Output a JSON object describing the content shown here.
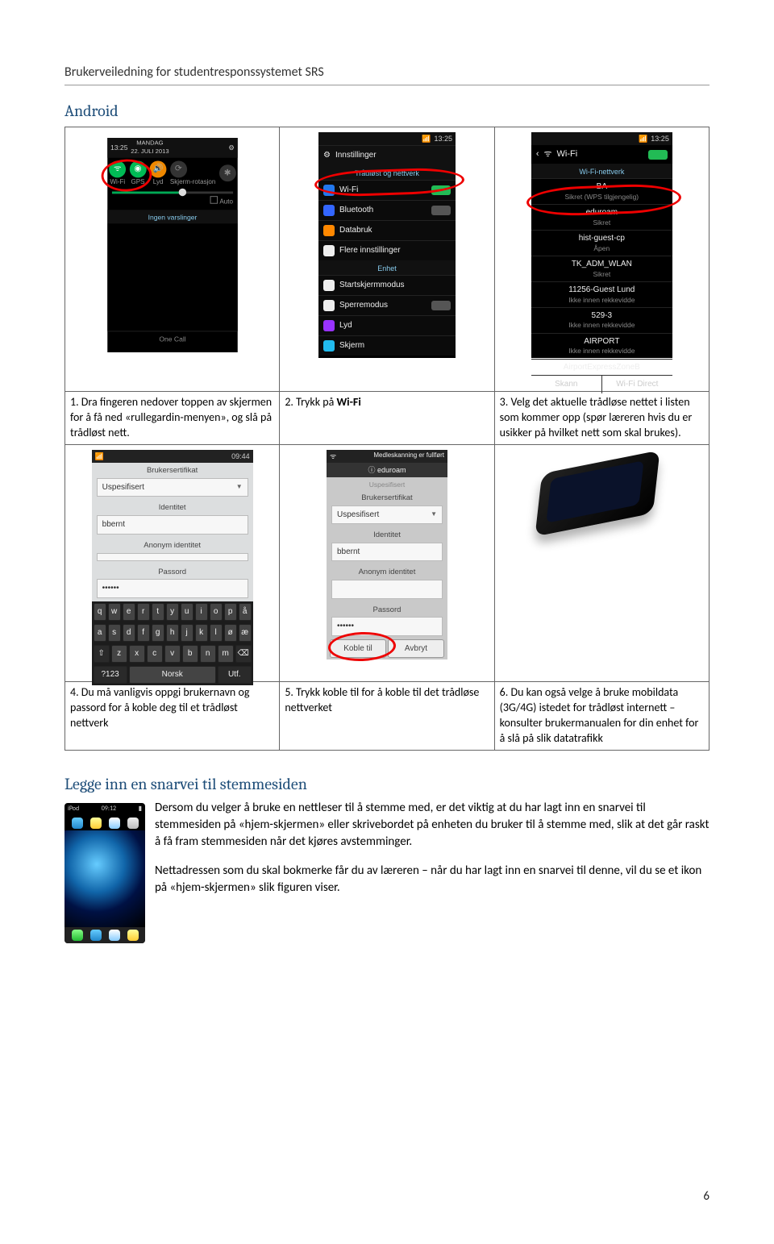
{
  "doc": {
    "header": "Brukerveiledning for studentresponssystemet SRS",
    "section_android": "Android",
    "section_shortcut": "Legge inn en snarvei til stemmesiden",
    "page_number": "6"
  },
  "steps_row1": {
    "c1": "1. Dra fingeren nedover toppen av skjermen for å få ned «rullegardin-menyen», og slå på trådløst nett.",
    "c2_pre": "2. Trykk på ",
    "c2_bold": "Wi-Fi",
    "c3": "3. Velg det aktuelle trådløse nettet i listen som kommer opp (spør læreren hvis du er usikker på hvilket nett som skal brukes)."
  },
  "steps_row2": {
    "c1": "4. Du må vanligvis oppgi brukernavn og passord for å koble deg til et trådløst nettverk",
    "c2": "5. Trykk koble til for å koble til det trådløse nettverket",
    "c3": "6. Du kan også velge å bruke mobildata (3G/4G) istedet for trådløst internett – konsulter brukermanualen for din enhet for å slå på slik datatrafikk"
  },
  "shortcut": {
    "p1": "Dersom du velger å bruke en nettleser til å stemme med, er det viktig at du har lagt inn en snarvei til stemmesiden på «hjem-skjermen» eller skrivebordet på enheten du bruker til å stemme med, slik at det går raskt å få fram stemmesiden når det kjøres avstemminger.",
    "p2": "Nettadressen som du skal bokmerke får du av læreren – når du har lagt inn en snarvei til denne, vil du se et ikon på «hjem-skjermen» slik figuren viser."
  },
  "screens": {
    "s1": {
      "time": "13:25",
      "day_line": "MANDAG",
      "date_line": "22. JULI 2013",
      "quick": [
        "Wi-Fi",
        "GPS",
        "Lyd",
        "Skjerm-rotasjon",
        ""
      ],
      "auto": "Auto",
      "noalerts": "Ingen varslinger",
      "carrier": "One Call"
    },
    "s2": {
      "time": "13:25",
      "title": "Innstillinger",
      "group1": "Trådløst og nettverk",
      "items": [
        "Wi-Fi",
        "Bluetooth",
        "Databruk",
        "Flere innstillinger"
      ],
      "group2": "Enhet",
      "items2": [
        "Startskjermmodus",
        "Sperremodus",
        "Lyd",
        "Skjerm"
      ]
    },
    "s3": {
      "time": "13:25",
      "title": "Wi-Fi",
      "subtitle": "Wi-Fi-nettverk",
      "networks": [
        {
          "name": "BA",
          "sub": "Sikret (WPS tilgjengelig)"
        },
        {
          "name": "eduroam",
          "sub": "Sikret"
        },
        {
          "name": "hist-guest-cp",
          "sub": "Åpen"
        },
        {
          "name": "TK_ADM_WLAN",
          "sub": "Sikret"
        },
        {
          "name": "11256-Guest Lund",
          "sub": "Ikke innen rekkevidde"
        },
        {
          "name": "529-3",
          "sub": "Ikke innen rekkevidde"
        },
        {
          "name": "AIRPORT",
          "sub": "Ikke innen rekkevidde"
        },
        {
          "name": "AirportExpressZoneB",
          "sub": ""
        }
      ],
      "foot": [
        "Skann",
        "Wi-Fi Direct"
      ]
    },
    "s4": {
      "time": "09:44",
      "lbl_cert": "Brukersertifikat",
      "val_cert": "Uspesifisert",
      "lbl_id": "Identitet",
      "val_id": "bbernt",
      "lbl_anon": "Anonym identitet",
      "val_anon": "",
      "lbl_pw": "Passord",
      "val_pw": "••••••",
      "kb_bottom": [
        "?123",
        "Norsk",
        "Utf."
      ]
    },
    "s5": {
      "scan": "Medleskanning er fullført",
      "info_net": "eduroam",
      "lbl_cert": "Brukersertifikat",
      "val_cert": "Uspesifisert",
      "lbl_id": "Identitet",
      "val_id": "bbernt",
      "lbl_anon": "Anonym identitet",
      "lbl_pw": "Passord",
      "val_pw": "••••••",
      "btn_connect": "Koble til",
      "btn_cancel": "Avbryt"
    },
    "ipod": {
      "left": "iPod",
      "time": "09:12",
      "batt": ""
    }
  }
}
